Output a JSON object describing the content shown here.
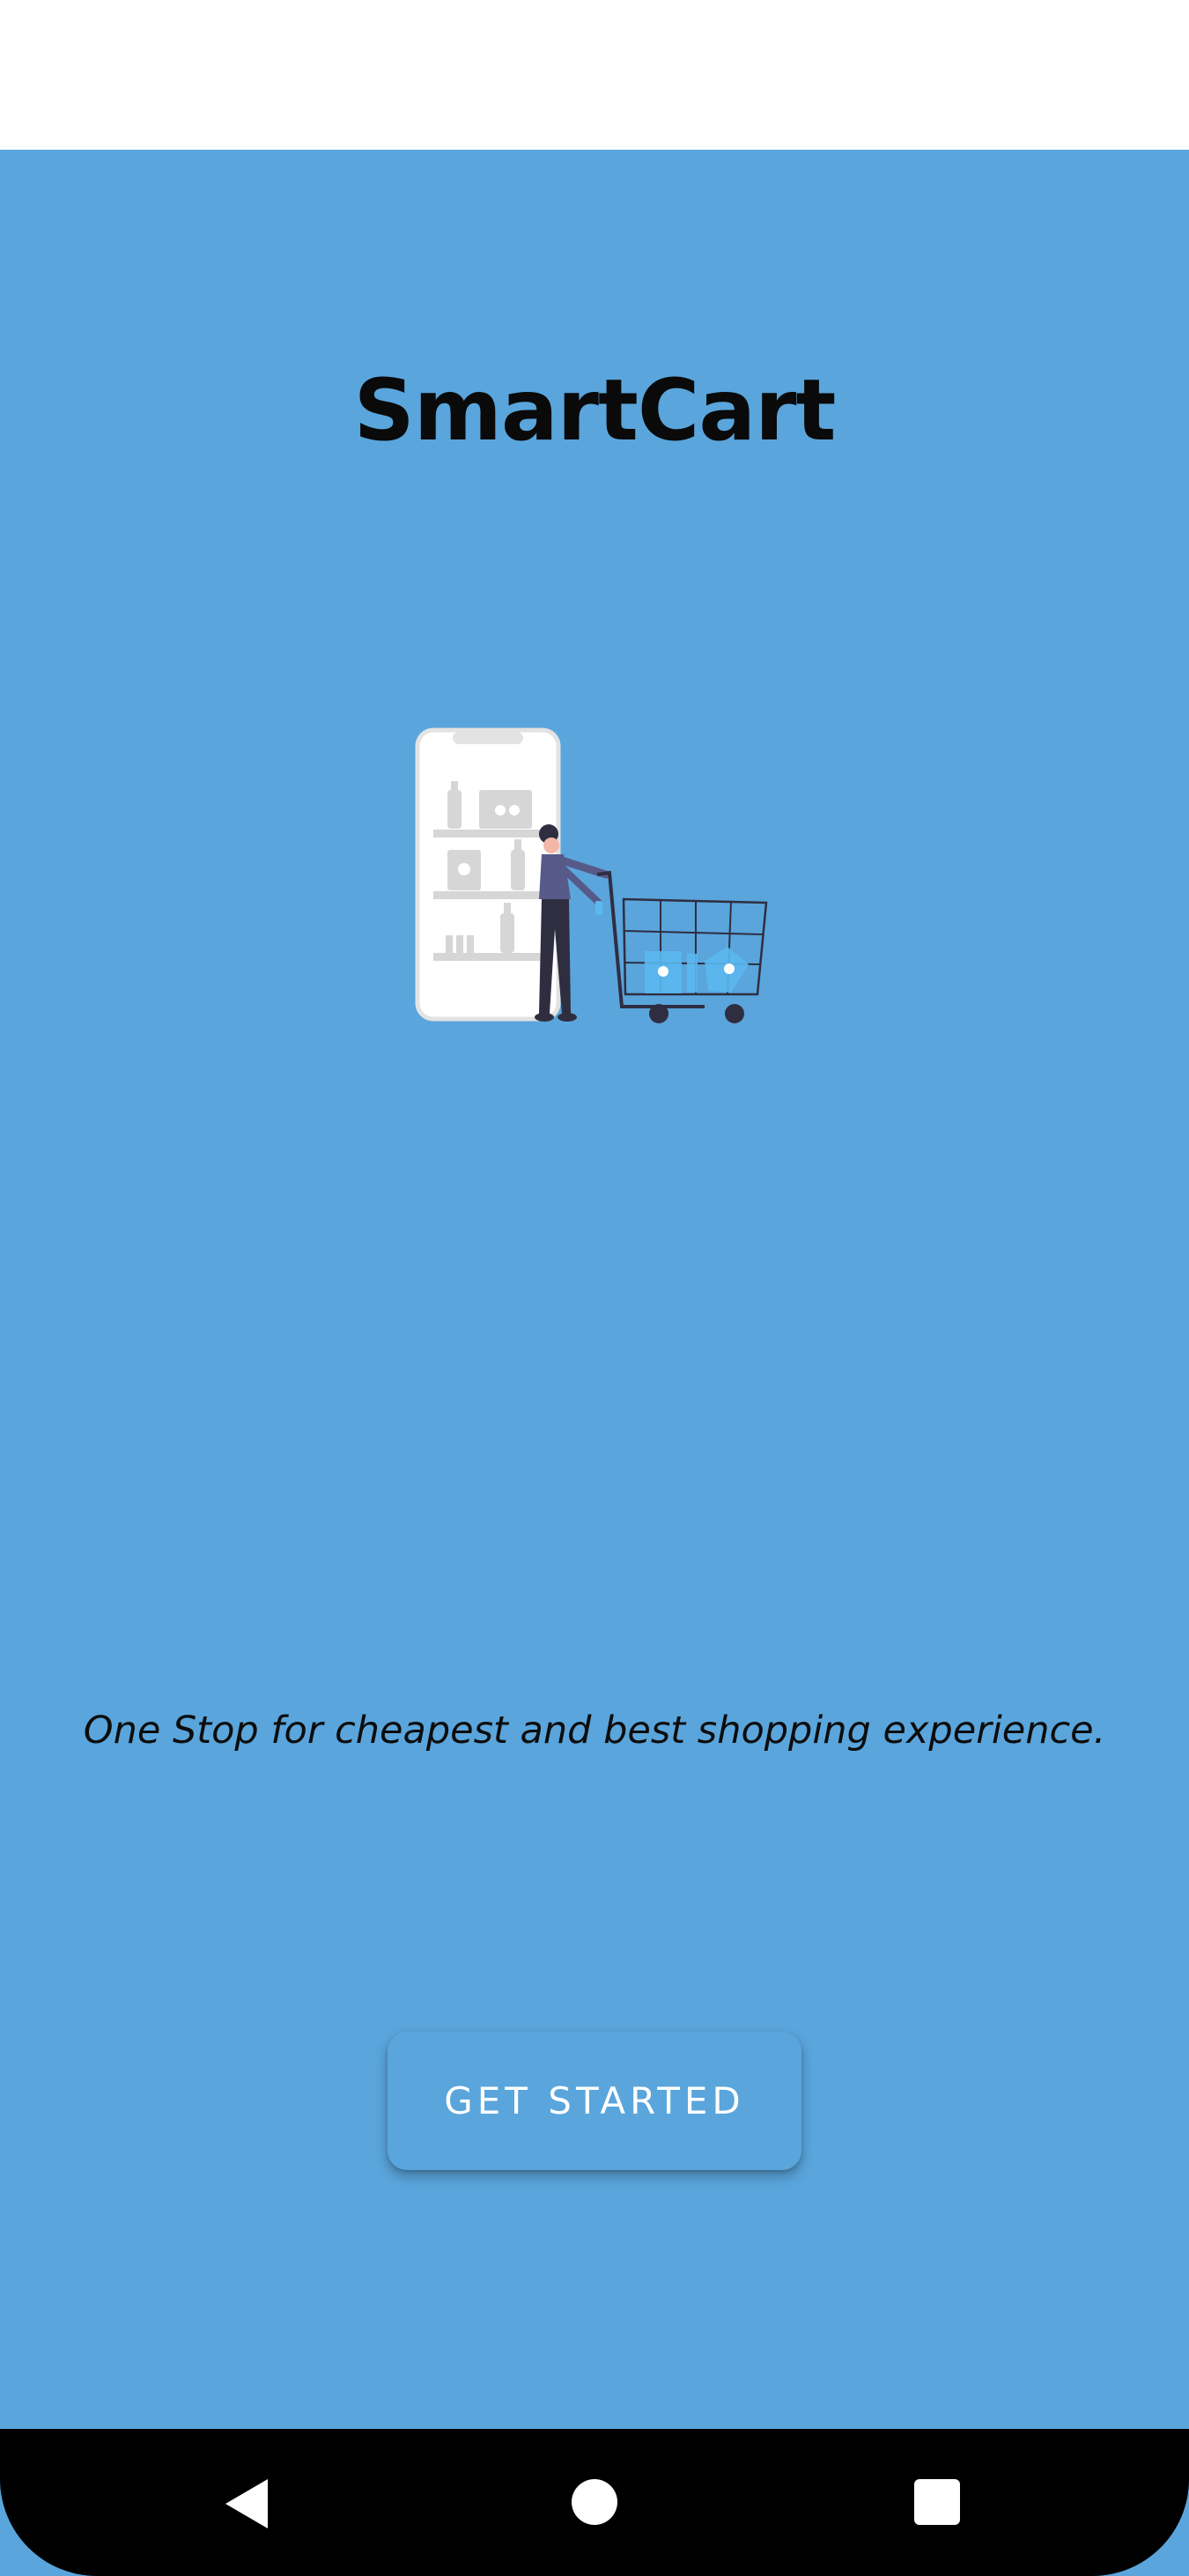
{
  "app": {
    "title": "SmartCart",
    "tagline": "One Stop for cheapest and best shopping experience.",
    "cta_label": "GET STARTED"
  },
  "illustration": {
    "icon": "woman-shopping-cart-with-phone-illustration"
  },
  "nav": {
    "back_icon": "back-triangle-icon",
    "home_icon": "home-circle-icon",
    "recents_icon": "recents-square-icon"
  },
  "colors": {
    "background": "#5aa5dc",
    "status_bar": "#ffffff",
    "nav_bar": "#000000",
    "button_text": "#ffffff"
  }
}
